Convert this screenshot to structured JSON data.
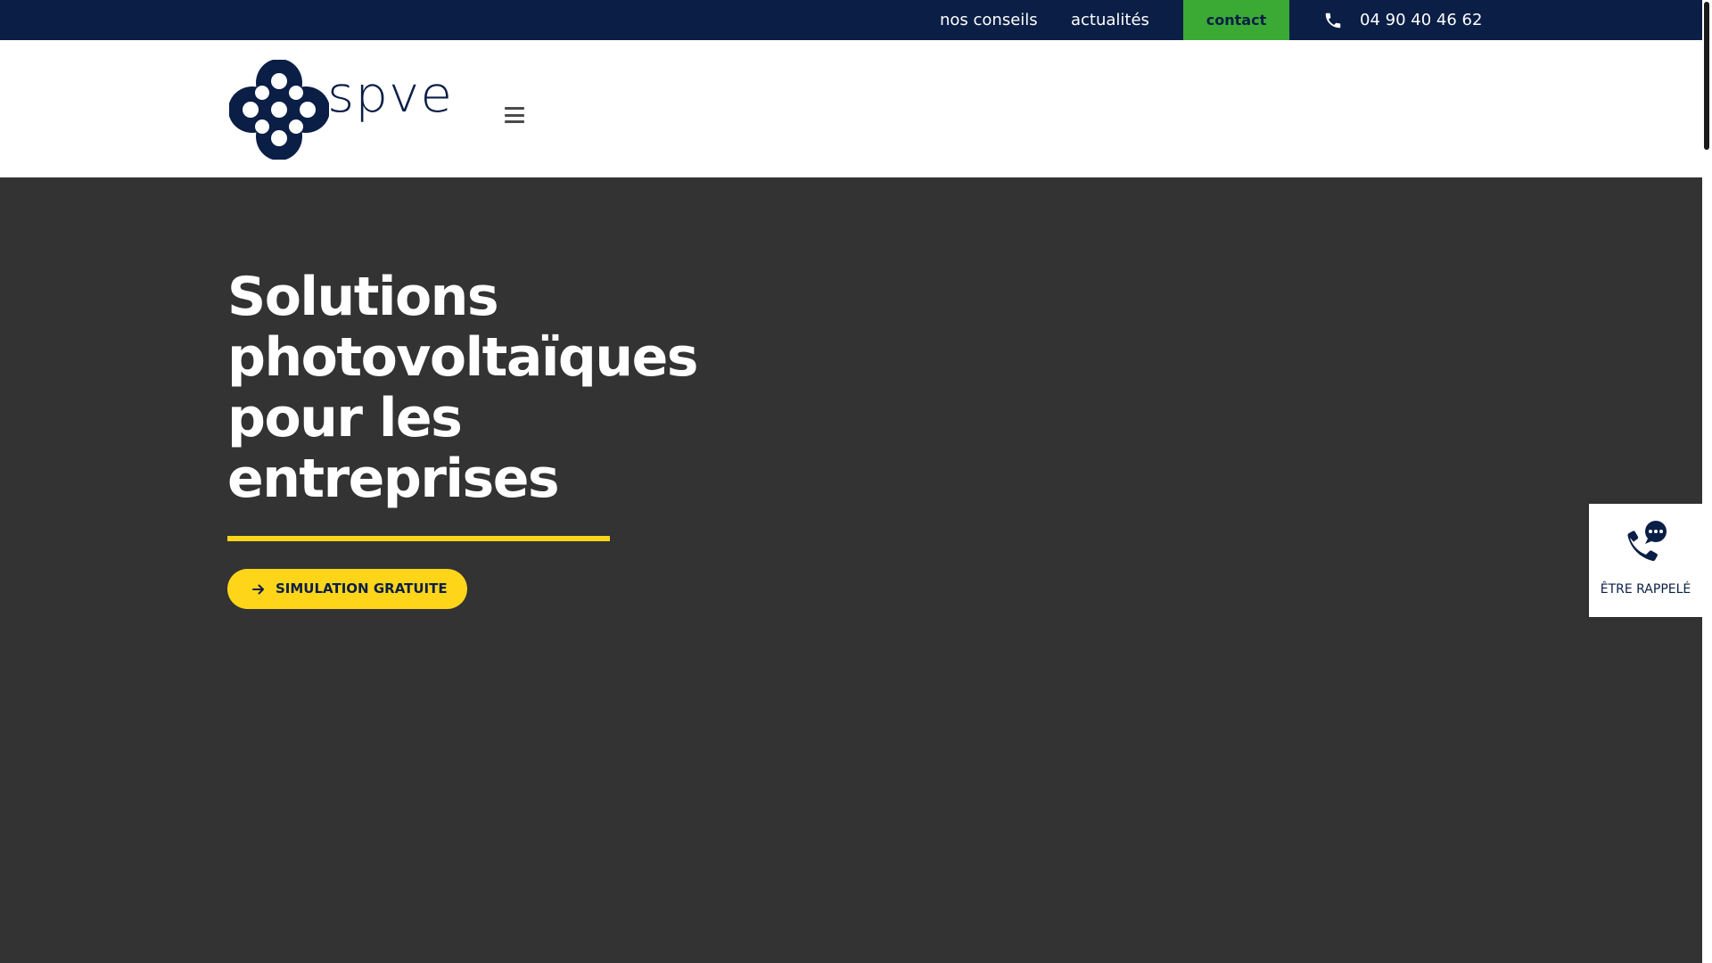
{
  "topbar": {
    "nav": [
      {
        "label": "nos conseils"
      },
      {
        "label": "actualités"
      }
    ],
    "contact_label": "contact",
    "phone": "04 90 40 46 62"
  },
  "header": {
    "logo_text": "spve",
    "menu_icon": "hamburger-menu-icon"
  },
  "hero": {
    "title": "Solutions photovoltaïques pour les entreprises",
    "cta_label": "SIMULATION GRATUITE",
    "cta_icon": "arrow-right-icon"
  },
  "callback": {
    "label": "ÊTRE RAPPELÉ",
    "icon": "phone-chat-icon"
  },
  "colors": {
    "navy": "#0a1e46",
    "green": "#3aaa35",
    "yellow": "#ffd51a",
    "hero_bg": "#333333"
  }
}
